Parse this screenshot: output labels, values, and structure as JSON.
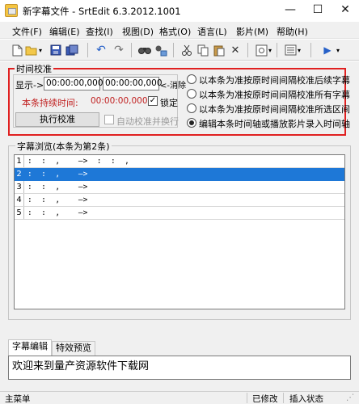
{
  "window": {
    "title": "新字幕文件 - SrtEdit 6.3.2012.1001",
    "minimize": "—",
    "maximize": "☐",
    "close": "✕"
  },
  "menu": [
    "文件(F)",
    "编辑(E)",
    "查找(I)",
    "视图(D)",
    "格式(O)",
    "语言(L)",
    "影片(M)",
    "帮助(H)"
  ],
  "toolbar_icons": [
    "new-file-icon",
    "open-folder-icon",
    "dropdown-arrow-icon",
    "save-icon",
    "save-as-icon",
    "undo-icon",
    "redo-icon",
    "find-icon",
    "replace-icon",
    "cut-icon",
    "copy-icon",
    "paste-icon",
    "delete-icon",
    "settings-icon",
    "video-icon",
    "list-icon",
    "play-icon"
  ],
  "time_calibration": {
    "title": "时间校准",
    "display_label": "显示->",
    "start_time": "00:00:00,000",
    "end_time": "00:00:00,000",
    "cancel_label": "<-消除",
    "duration_label": "本条持续时间:",
    "duration_value": "00:00:00,000",
    "lock_label": "锁定",
    "lock_checked": true,
    "execute_button": "执行校准",
    "auto_calibrate_label": "自动校准并换行",
    "auto_calibrate_checked": false,
    "options": [
      {
        "label": "以本条为准按原时间间隔校准后续字幕",
        "selected": false
      },
      {
        "label": "以本条为准按原时间间隔校准所有字幕",
        "selected": false
      },
      {
        "label": "以本条为准按原时间间隔校准所选区间",
        "selected": false
      },
      {
        "label": "编辑本条时间轴或播放影片录入时间轴",
        "selected": true
      }
    ]
  },
  "subtitle_browser": {
    "title": "字幕浏览(本条为第2条)",
    "selected_index": 1,
    "rows": [
      {
        "num": "1",
        "time": ":  :  ,    —>  :  :  ,"
      },
      {
        "num": "2",
        "time": ":  :  ,    —>"
      },
      {
        "num": "3",
        "time": ":  :  ,    —>"
      },
      {
        "num": "4",
        "time": ":  :  ,    —>"
      },
      {
        "num": "5",
        "time": ":  :  ,    —>"
      }
    ]
  },
  "editor": {
    "tabs": [
      "字幕编辑",
      "特效预览"
    ],
    "active_tab": 0,
    "content": "欢迎来到量产资源软件下载网"
  },
  "status": {
    "main_menu": "主菜单",
    "modified": "已修改",
    "insert_mode": "插入状态"
  },
  "colors": {
    "highlight_border": "#e02020",
    "selection": "#1e78d7"
  }
}
